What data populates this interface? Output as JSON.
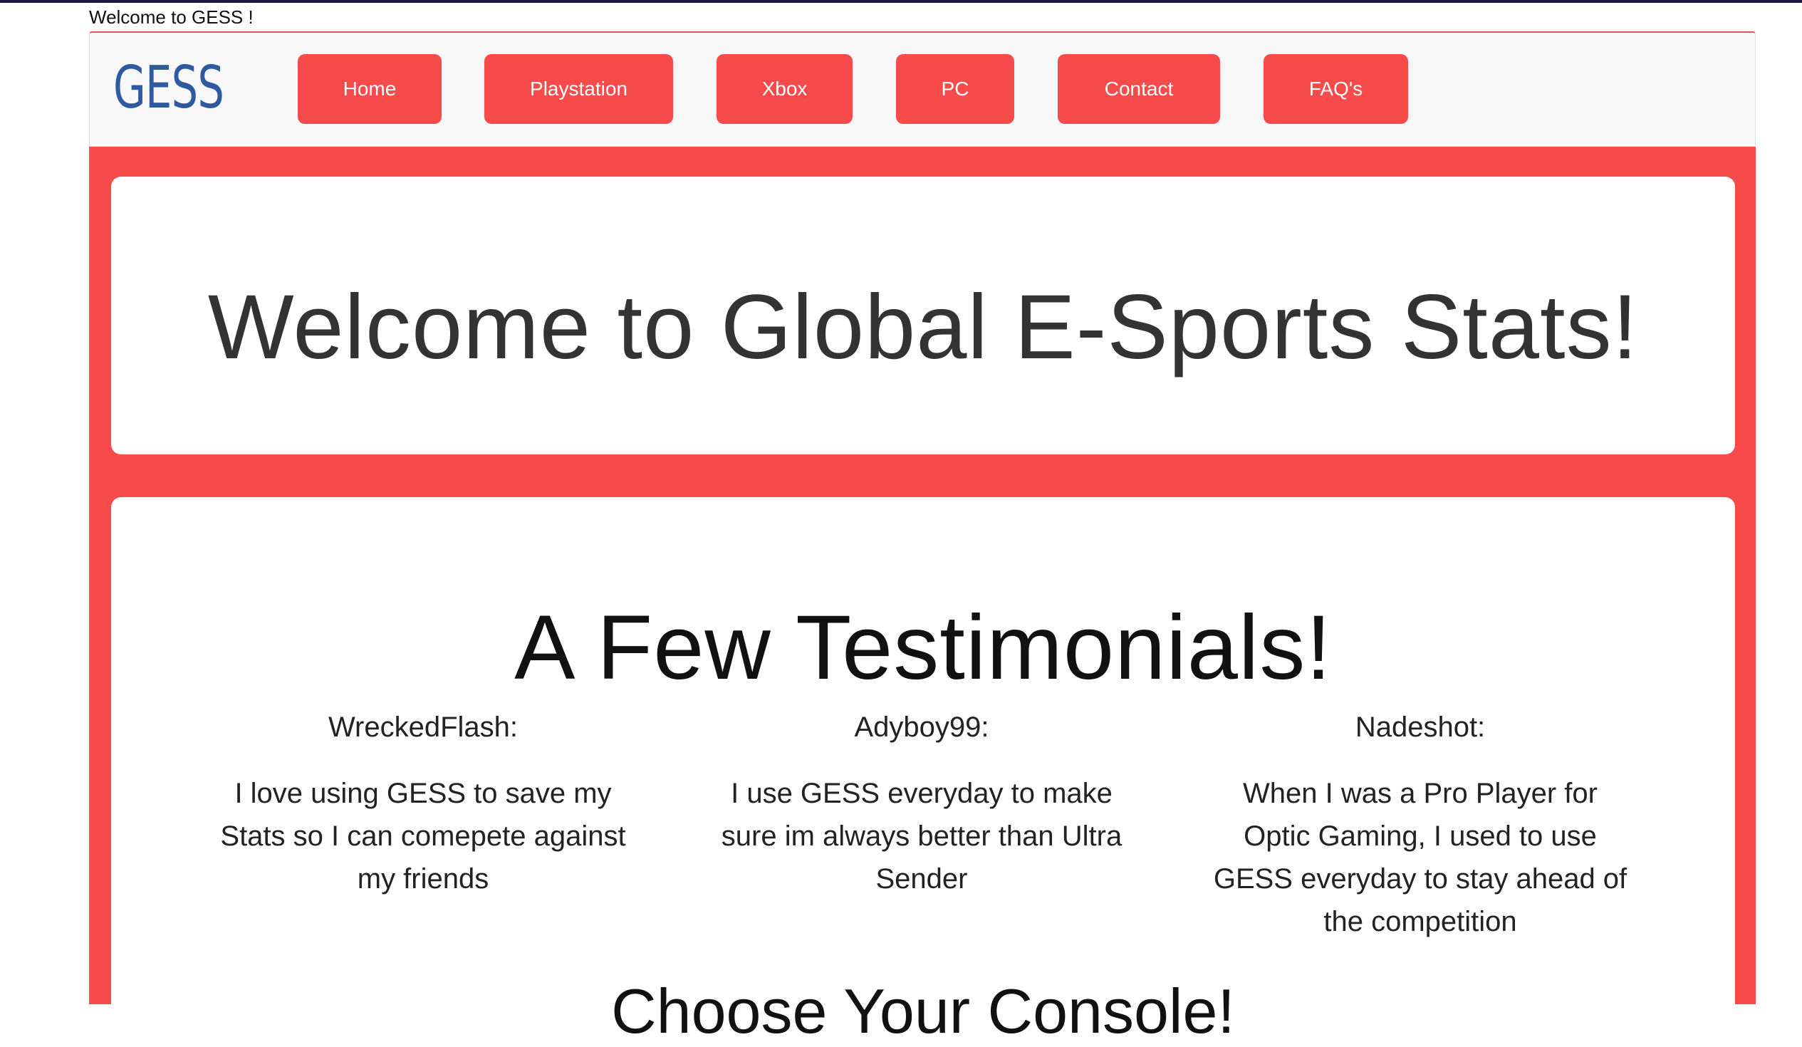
{
  "page": {
    "caption": "Welcome to GESS !"
  },
  "navbar": {
    "brand": "GESS",
    "items": [
      {
        "label": "Home"
      },
      {
        "label": "Playstation"
      },
      {
        "label": "Xbox"
      },
      {
        "label": "PC"
      },
      {
        "label": "Contact"
      },
      {
        "label": "FAQ's"
      }
    ]
  },
  "hero": {
    "title": "Welcome to Global E-Sports Stats!"
  },
  "testimonials": {
    "title": "A Few Testimonials!",
    "items": [
      {
        "name": "WreckedFlash:",
        "quote": "I love using GESS to save my Stats so I can comepete against my friends"
      },
      {
        "name": "Adyboy99:",
        "quote": "I use GESS everyday to make sure im always better than Ultra Sender"
      },
      {
        "name": "Nadeshot:",
        "quote": "When I was a Pro Player for Optic Gaming, I used to use GESS everyday to stay ahead of the competition"
      }
    ],
    "next_heading": "Choose Your Console!"
  },
  "colors": {
    "accent_red": "#f74b4b",
    "brand_blue": "#2f5aa0",
    "navbar_bg": "#f8f8f8",
    "panel_bg": "#ffffff",
    "heading_text": "#333333"
  }
}
